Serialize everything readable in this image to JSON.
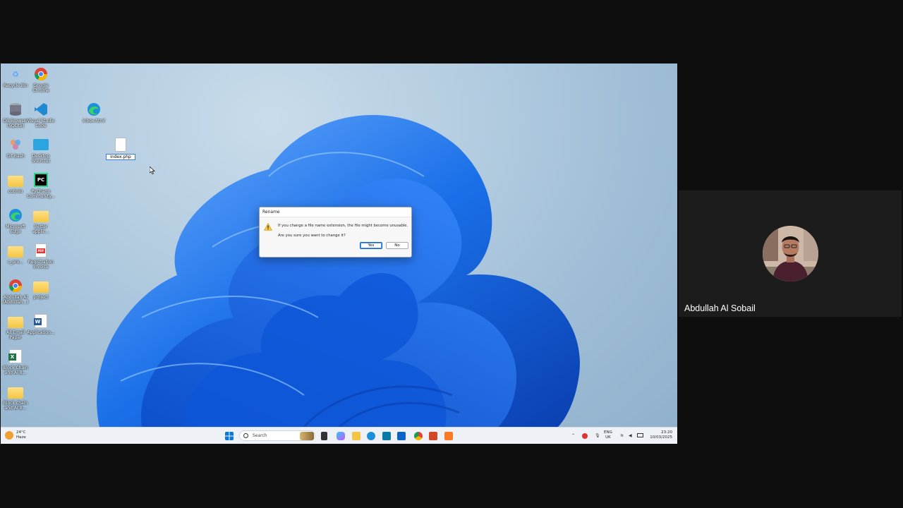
{
  "desktop": {
    "icons": [
      {
        "label": "Recycle Bin",
        "icon": "recycle-bin-icon"
      },
      {
        "label": "Google Chrome",
        "icon": "chrome-icon"
      },
      {
        "label": "DB Browser (SQLite)",
        "icon": "database-icon"
      },
      {
        "label": "Visual Studio Code",
        "icon": "vscode-icon"
      },
      {
        "label": "Git Bash",
        "icon": "git-bash-icon"
      },
      {
        "label": "Desktop Shortcut",
        "icon": "desktop-shortcut-icon"
      },
      {
        "label": "cotmin",
        "icon": "folder-icon"
      },
      {
        "label": "PyCharm Community...",
        "icon": "pycharm-icon"
      },
      {
        "label": "Microsoft Edge",
        "icon": "edge-icon"
      },
      {
        "label": "Better applic...",
        "icon": "folder-icon"
      },
      {
        "label": "c_pro...",
        "icon": "folder-icon"
      },
      {
        "label": "Registration Invoice",
        "icon": "pdf-icon"
      },
      {
        "label": "Abdullah Al (Abdullah...)",
        "icon": "chrome-icon"
      },
      {
        "label": "project",
        "icon": "folder-icon"
      },
      {
        "label": "All Email Paper",
        "icon": "folder-icon"
      },
      {
        "label": "Application...",
        "icon": "word-icon"
      },
      {
        "label": "Block Chain and Ai B...",
        "icon": "excel-icon"
      },
      {
        "label": "Block chain and AI B...",
        "icon": "folder-icon"
      },
      {
        "label": "Inbox.html",
        "icon": "edge-icon"
      },
      {
        "label": "index.php",
        "icon": "file-icon"
      }
    ]
  },
  "dialog": {
    "title": "Rename",
    "message": "If you change a file name extension, the file might become unusable.",
    "question": "Are you sure you want to change it?",
    "yes_label": "Yes",
    "no_label": "No"
  },
  "taskbar": {
    "weather_temp": "24°C",
    "weather_desc": "Haze",
    "search_placeholder": "Search",
    "language": "ENG",
    "region": "UK",
    "time": "23:20",
    "date": "10/03/2025"
  },
  "participant": {
    "name": "Abdullah Al Sobail"
  },
  "colors": {
    "accent": "#0a64c8",
    "wallpaper_bloom": "#1a6fe8",
    "tile_bg": "#1c1c1c"
  }
}
